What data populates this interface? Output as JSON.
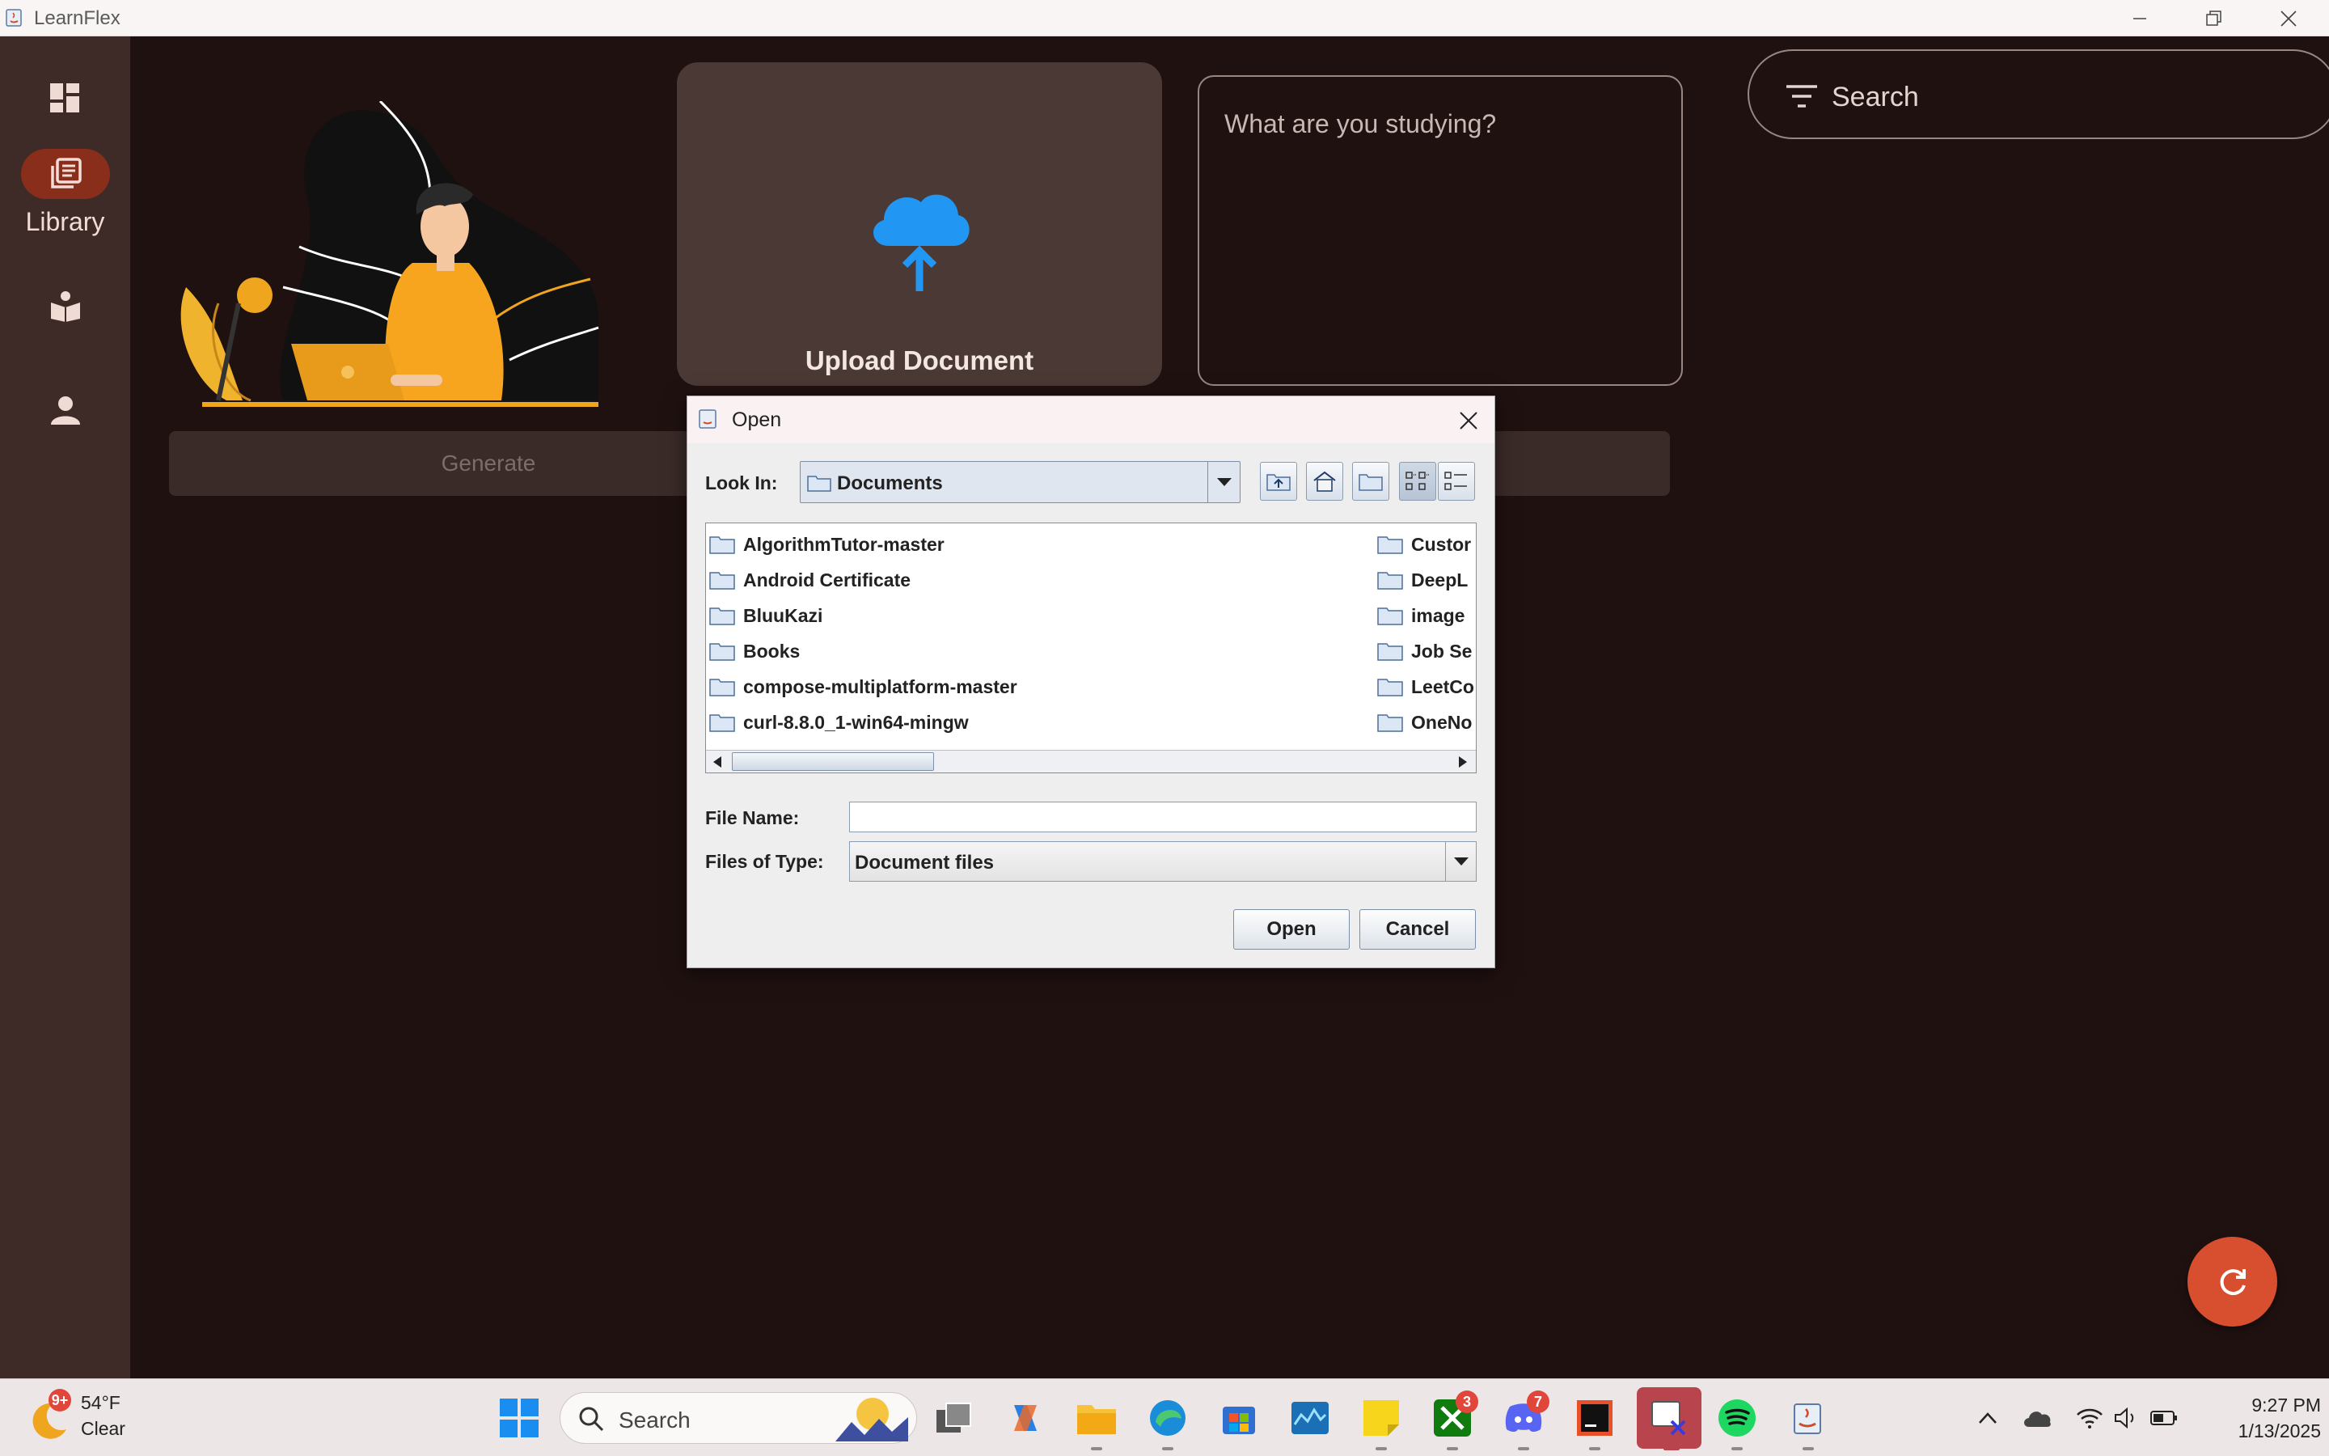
{
  "window": {
    "title": "LearnFlex"
  },
  "rail": {
    "items": [
      {
        "icon": "dashboard-icon",
        "label": ""
      },
      {
        "icon": "library-icon",
        "label": "Library"
      },
      {
        "icon": "reading-icon",
        "label": ""
      },
      {
        "icon": "profile-icon",
        "label": ""
      }
    ]
  },
  "upload": {
    "label": "Upload Document"
  },
  "study": {
    "placeholder": "What are you studying?"
  },
  "search": {
    "placeholder": "Search"
  },
  "generate": {
    "label": "Generate"
  },
  "dialog": {
    "title": "Open",
    "look_in_label": "Look In:",
    "look_in_value": "Documents",
    "files_left": [
      "AlgorithmTutor-master",
      "Android Certificate",
      "BluuKazi",
      "Books",
      "compose-multiplatform-master",
      "curl-8.8.0_1-win64-mingw"
    ],
    "files_right": [
      "Custor",
      "DeepL",
      "image",
      "Job Se",
      "LeetCo",
      "OneNo"
    ],
    "file_name_label": "File Name:",
    "file_name_value": "",
    "file_type_label": "Files of Type:",
    "file_type_value": "Document files",
    "open_label": "Open",
    "cancel_label": "Cancel"
  },
  "taskbar": {
    "weather_temp": "54°F",
    "weather_cond": "Clear",
    "weather_badge": "9+",
    "search_label": "Search",
    "xbox_badge": "3",
    "discord_badge": "7",
    "time": "9:27 PM",
    "date": "1/13/2025"
  },
  "colors": {
    "accent": "#d84f2f",
    "rail": "#3e2b28",
    "background": "#1f1110",
    "cloud": "#2196f3"
  }
}
